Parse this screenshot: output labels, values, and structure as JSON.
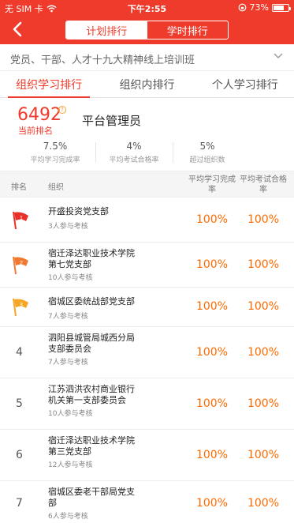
{
  "status": {
    "carrier": "无 SIM 卡",
    "time": "下午2:55",
    "battery": "73%",
    "battery_level": 0.73
  },
  "nav": {
    "tabs": [
      "计划排行",
      "学时排行"
    ],
    "active_index": 0
  },
  "course": {
    "title": "党员、干部、人才十九大精神线上培训班"
  },
  "tabs": [
    "组织学习排行",
    "组织内排行",
    "个人学习排行"
  ],
  "summary": {
    "rank": "6492",
    "rank_label": "当前排名",
    "org_name": "平台管理员",
    "stats": [
      {
        "value": "7.5%",
        "label": "平均学习完成率"
      },
      {
        "value": "4%",
        "label": "平均考试合格率"
      },
      {
        "value": "5%",
        "label": "超过组织数"
      }
    ]
  },
  "table": {
    "headers": {
      "rank": "排名",
      "org": "组织",
      "completion": "平均学习完成率",
      "pass": "平均考试合格率"
    },
    "rows": [
      {
        "rank": "1",
        "name": "开盛投资党支部",
        "sub": "3人参与考核",
        "completion": "100%",
        "pass": "100%",
        "flag_color": "#e8312a"
      },
      {
        "rank": "2",
        "name": "宿迁泽达职业技术学院第七党支部",
        "sub": "10人参与考核",
        "completion": "100%",
        "pass": "100%",
        "flag_color": "#f07a32"
      },
      {
        "rank": "3",
        "name": "宿城区委统战部党支部",
        "sub": "7人参与考核",
        "completion": "100%",
        "pass": "100%",
        "flag_color": "#f6a625"
      },
      {
        "rank": "4",
        "name": "泗阳县城管局城西分局支部委员会",
        "sub": "7人参与考核",
        "completion": "100%",
        "pass": "100%"
      },
      {
        "rank": "5",
        "name": "江苏泗洪农村商业银行机关第一支部委员会",
        "sub": "10人参与考核",
        "completion": "100%",
        "pass": "100%"
      },
      {
        "rank": "6",
        "name": "宿迁泽达职业技术学院第三党支部",
        "sub": "12人参与考核",
        "completion": "100%",
        "pass": "100%"
      },
      {
        "rank": "7",
        "name": "宿城区委老干部局党支部",
        "sub": "6人参与考核",
        "completion": "100%",
        "pass": "100%"
      }
    ]
  },
  "colors": {
    "brand": "#ee3b2b",
    "value": "#ff6a00"
  },
  "icons": [
    "back-icon",
    "wifi-icon",
    "chevron-down-icon",
    "question-icon",
    "rank-flag-icon",
    "lock-rotation-icon"
  ]
}
